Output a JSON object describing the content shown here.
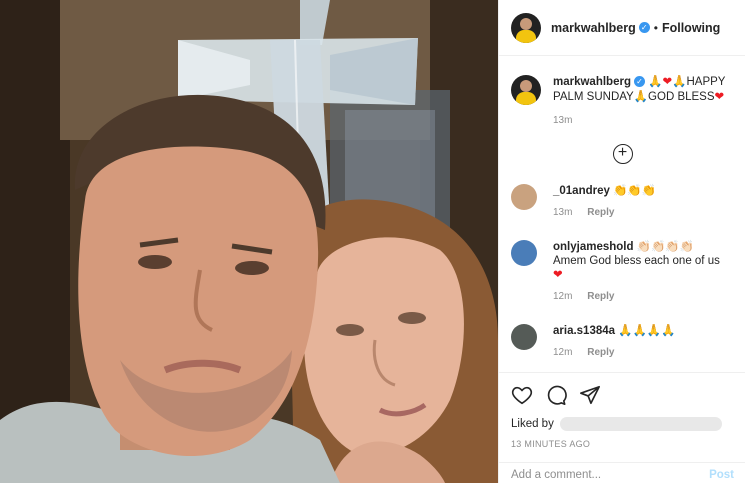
{
  "post": {
    "photo": {
      "description_icon": "photo"
    },
    "header": {
      "username": "markwahlberg",
      "verified_mark": "✓",
      "separator": "•",
      "follow_status": "Following"
    },
    "caption": {
      "username": "markwahlberg",
      "text_before": "🙏",
      "heart": "❤",
      "text_mid": "🙏HAPPY PALM SUNDAY🙏GOD BLESS",
      "heart2": "❤",
      "time": "13m"
    },
    "load_more_icon": "+",
    "comments": [
      {
        "username": "_01andrey",
        "text": "👏👏👏",
        "time": "13m",
        "reply": "Reply",
        "avatar_color": "#c9a27f"
      },
      {
        "username": "onlyjameshold",
        "text": "👏🏻👏🏻👏🏻👏🏻",
        "text2": "Amem God bless each one of us",
        "heart": "❤",
        "time": "12m",
        "reply": "Reply",
        "avatar_color": "#4a7db8"
      },
      {
        "username": "aria.s1384a",
        "text": "🙏🙏🙏🙏",
        "time": "12m",
        "reply": "Reply",
        "avatar_color": "#555b57"
      }
    ],
    "actions": {
      "liked_by": "Liked by",
      "time_ago": "13 MINUTES AGO"
    },
    "add_comment": {
      "placeholder": "Add a comment...",
      "post_label": "Post"
    }
  },
  "colors": {
    "verified": "#3897f0",
    "heart": "#ed1c24",
    "meta": "#8e8e8e",
    "border": "#efefef"
  }
}
